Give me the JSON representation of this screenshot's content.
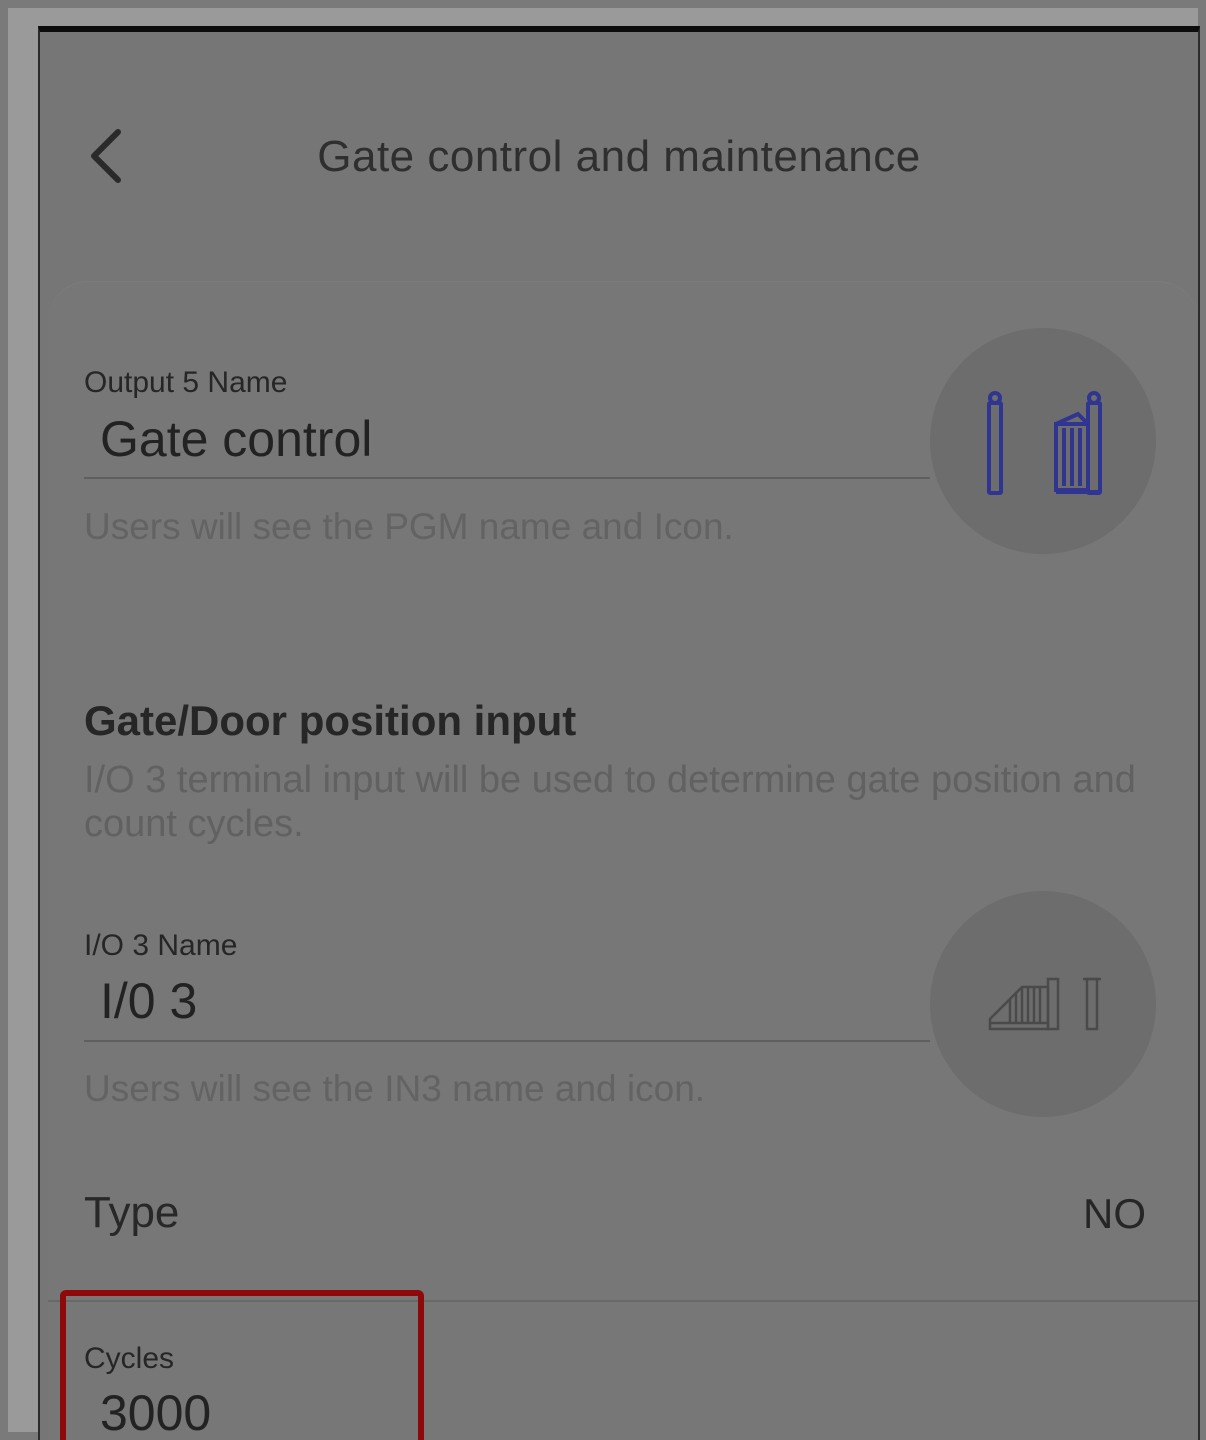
{
  "header": {
    "title": "Gate control and maintenance",
    "back_icon": "chevron-left-icon"
  },
  "output": {
    "label": "Output 5 Name",
    "value": "Gate control",
    "hint": "Users will see the PGM name and Icon.",
    "icon": "gate-closed-icon",
    "icon_color": "#2f3590"
  },
  "position_section": {
    "title": "Gate/Door position input",
    "description": "I/O 3 terminal input will be used to determine gate position and count cycles."
  },
  "io": {
    "label": "I/O 3 Name",
    "value": "I/0 3",
    "hint": "Users will see the IN3 name and icon.",
    "icon": "gate-open-icon"
  },
  "type_row": {
    "label": "Type",
    "value": "NO"
  },
  "cycles": {
    "label": "Cycles",
    "value": "3000",
    "highlight_color": "#8e0a0a"
  },
  "colors": {
    "overlay": "#767676",
    "icon_circle": "#6d6d6d",
    "highlight": "#8e0a0a"
  }
}
